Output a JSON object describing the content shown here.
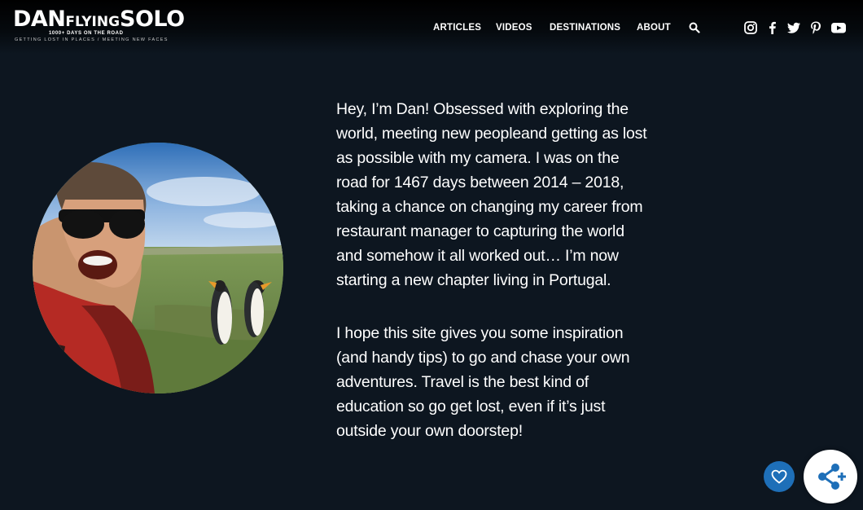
{
  "header": {
    "logo": {
      "word1": "DAN",
      "word2": "FLYING",
      "word3": "SOLO",
      "tagline": "1000+ DAYS ON THE ROAD",
      "subtitle": "GETTING LOST IN PLACES / MEETING NEW FACES"
    },
    "nav": [
      {
        "label": "ARTICLES"
      },
      {
        "label": "VIDEOS"
      },
      {
        "label": "DESTINATIONS"
      },
      {
        "label": "ABOUT"
      }
    ],
    "search_icon": "search-icon",
    "social": [
      "instagram-icon",
      "facebook-icon",
      "twitter-icon",
      "pinterest-icon",
      "youtube-icon"
    ]
  },
  "main": {
    "paragraphs": [
      "Hey, I’m Dan! Obsessed with exploring the world, meeting new peopleand getting as lost as possible with my camera. I was on the road for 1467 days between 2014 – 2018, taking a chance on changing my career from restaurant manager to capturing the world and somehow it all worked out… I’m now starting a new chapter living in Portugal.",
      "I hope this site gives you some inspiration (and handy tips) to go and chase your own adventures. Travel is the best kind of education so go get lost, even if it’s just outside your own doorstep!"
    ]
  },
  "floating": {
    "like_icon": "heart-icon",
    "share_icon": "share-icon"
  },
  "colors": {
    "background": "#0d1620",
    "text": "#ffffff",
    "like_button": "#1e6fb8",
    "share_button": "#ffffff",
    "share_icon": "#1e6fb8"
  }
}
